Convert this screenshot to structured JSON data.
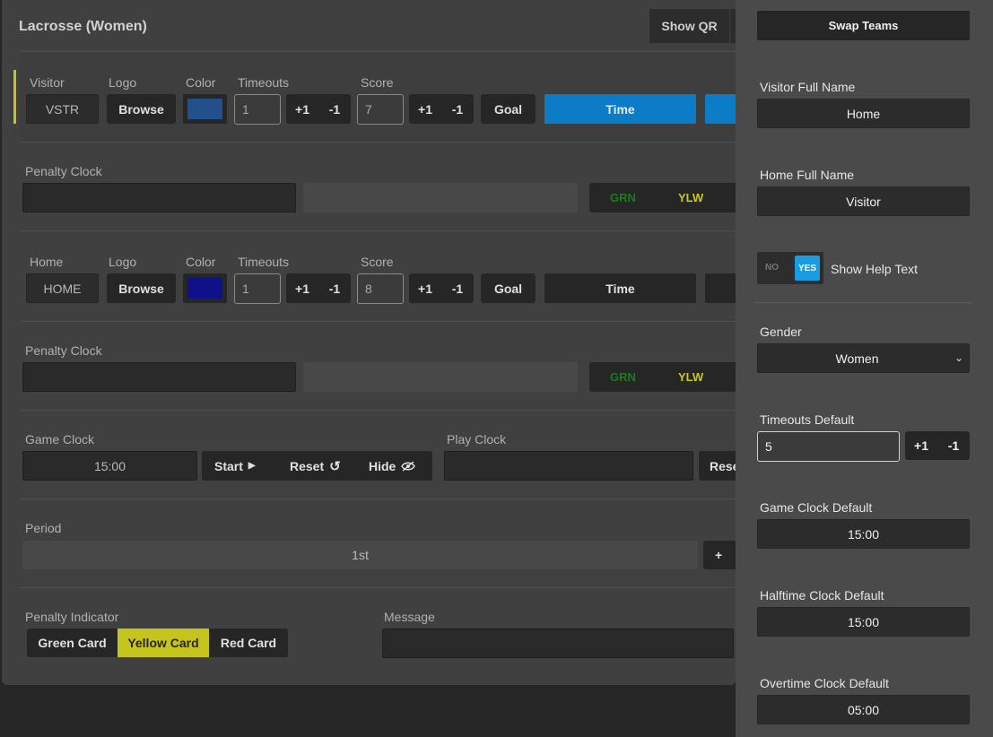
{
  "app": {
    "title": "Lacrosse (Women)",
    "show_qr": "Show QR"
  },
  "visitor": {
    "label": "Visitor",
    "abbr": "VSTR",
    "logo_label": "Logo",
    "logo_button": "Browse",
    "color_label": "Color",
    "color": "#23508a",
    "timeouts_label": "Timeouts",
    "timeouts": "1",
    "score_label": "Score",
    "score": "7",
    "plus": "+1",
    "minus": "-1",
    "goal": "Goal",
    "time": "Time",
    "penalty_label": "Penalty Clock",
    "grn": "GRN",
    "ylw": "YLW"
  },
  "home": {
    "label": "Home",
    "abbr": "HOME",
    "logo_label": "Logo",
    "logo_button": "Browse",
    "color_label": "Color",
    "color": "#10108a",
    "timeouts_label": "Timeouts",
    "timeouts": "1",
    "score_label": "Score",
    "score": "8",
    "plus": "+1",
    "minus": "-1",
    "goal": "Goal",
    "time": "Time",
    "penalty_label": "Penalty Clock",
    "grn": "GRN",
    "ylw": "YLW"
  },
  "game_clock": {
    "label": "Game Clock",
    "value": "15:00",
    "start": "Start",
    "reset": "Reset",
    "hide": "Hide"
  },
  "play_clock": {
    "label": "Play Clock",
    "reset": "Rese"
  },
  "period": {
    "label": "Period",
    "value": "1st",
    "plus": "+"
  },
  "penalty_indicator": {
    "label": "Penalty Indicator",
    "options": [
      "Green Card",
      "Yellow Card",
      "Red Card"
    ],
    "selected": "Yellow Card"
  },
  "message": {
    "label": "Message",
    "value": ""
  },
  "sidebar": {
    "swap": "Swap Teams",
    "visitor_full_label": "Visitor Full Name",
    "visitor_full": "Home",
    "home_full_label": "Home Full Name",
    "home_full": "Visitor",
    "help_no": "NO",
    "help_yes": "YES",
    "help_label": "Show Help Text",
    "gender_label": "Gender",
    "gender": "Women",
    "timeouts_default_label": "Timeouts Default",
    "timeouts_default": "5",
    "plus": "+1",
    "minus": "-1",
    "game_clock_default_label": "Game Clock Default",
    "game_clock_default": "15:00",
    "halftime_default_label": "Halftime Clock Default",
    "halftime_default": "15:00",
    "overtime_default_label": "Overtime Clock Default",
    "overtime_default": "05:00"
  },
  "colors": {
    "accent_yellow": "#c4c41c",
    "time_blue": "#0c7cc7",
    "toggle_blue": "#1a9ce2",
    "grn_text": "#1f7a1f",
    "ylw_text": "#c8c81e"
  },
  "icons": {
    "start": "play-icon",
    "reset": "reset-icon",
    "hide": "eye-off-icon",
    "chevron": "chevron-down-icon"
  }
}
